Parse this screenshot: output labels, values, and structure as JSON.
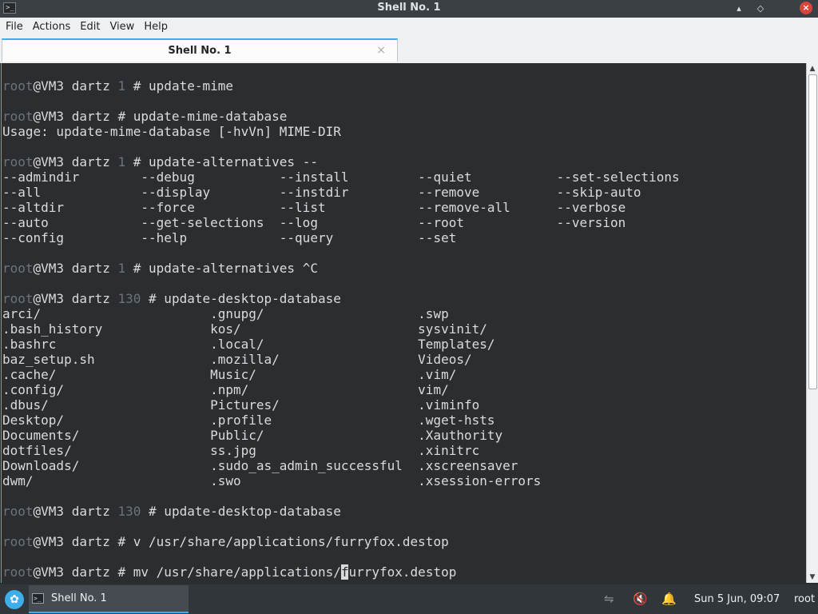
{
  "window": {
    "title": "Shell No. 1",
    "app_icon": "terminal-icon",
    "minimize_glyph": "▴",
    "maximize_glyph": "◇",
    "close_glyph": "×"
  },
  "menu": [
    "File",
    "Actions",
    "Edit",
    "View",
    "Help"
  ],
  "tab": {
    "label": "Shell No. 1",
    "close_glyph": "×"
  },
  "terminal": {
    "lines": [
      [
        {
          "t": "root",
          "c": "dim"
        },
        {
          "t": "@VM3 dartz "
        },
        {
          "t": "1",
          "c": "dim"
        },
        {
          "t": " # update-mime"
        }
      ],
      [],
      [
        {
          "t": "root",
          "c": "dim"
        },
        {
          "t": "@VM3 dartz # update-mime-database"
        }
      ],
      [
        {
          "t": "Usage: update-mime-database [-hvVn] MIME-DIR"
        }
      ],
      [],
      [
        {
          "t": "root",
          "c": "dim"
        },
        {
          "t": "@VM3 dartz "
        },
        {
          "t": "1",
          "c": "dim"
        },
        {
          "t": " # update-alternatives --"
        }
      ],
      [
        {
          "t": "--admindir        --debug           --install         --quiet           --set-selections"
        }
      ],
      [
        {
          "t": "--all             --display         --instdir         --remove          --skip-auto"
        }
      ],
      [
        {
          "t": "--altdir          --force           --list            --remove-all      --verbose"
        }
      ],
      [
        {
          "t": "--auto            --get-selections  --log             --root            --version"
        }
      ],
      [
        {
          "t": "--config          --help            --query           --set"
        }
      ],
      [],
      [
        {
          "t": "root",
          "c": "dim"
        },
        {
          "t": "@VM3 dartz "
        },
        {
          "t": "1",
          "c": "dim"
        },
        {
          "t": " # update-alternatives ^C"
        }
      ],
      [],
      [
        {
          "t": "root",
          "c": "dim"
        },
        {
          "t": "@VM3 dartz "
        },
        {
          "t": "130",
          "c": "dim"
        },
        {
          "t": " # update-desktop-database"
        }
      ],
      [
        {
          "t": "arci/                      .gnupg/                    .swp"
        }
      ],
      [
        {
          "t": ".bash_history              kos/                       sysvinit/"
        }
      ],
      [
        {
          "t": ".bashrc                    .local/                    Templates/"
        }
      ],
      [
        {
          "t": "baz_setup.sh               .mozilla/                  Videos/"
        }
      ],
      [
        {
          "t": ".cache/                    Music/                     .vim/"
        }
      ],
      [
        {
          "t": ".config/                   .npm/                      vim/"
        }
      ],
      [
        {
          "t": ".dbus/                     Pictures/                  .viminfo"
        }
      ],
      [
        {
          "t": "Desktop/                   .profile                   .wget-hsts"
        }
      ],
      [
        {
          "t": "Documents/                 Public/                    .Xauthority"
        }
      ],
      [
        {
          "t": "dotfiles/                  ss.jpg                     .xinitrc"
        }
      ],
      [
        {
          "t": "Downloads/                 .sudo_as_admin_successful  .xscreensaver"
        }
      ],
      [
        {
          "t": "dwm/                       .swo                       .xsession-errors"
        }
      ],
      [],
      [
        {
          "t": "root",
          "c": "dim"
        },
        {
          "t": "@VM3 dartz "
        },
        {
          "t": "130",
          "c": "dim"
        },
        {
          "t": " # update-desktop-database"
        }
      ],
      [],
      [
        {
          "t": "root",
          "c": "dim"
        },
        {
          "t": "@VM3 dartz # v /usr/share/applications/furryfox.destop"
        }
      ],
      [],
      [
        {
          "t": "root",
          "c": "dim"
        },
        {
          "t": "@VM3 dartz # mv /usr/share/applications/"
        },
        {
          "t": "f",
          "c": "cursor"
        },
        {
          "t": "urryfox.destop"
        }
      ]
    ]
  },
  "scrollbar": {
    "up_glyph": "▲",
    "down_glyph": "▼"
  },
  "taskbar": {
    "launcher_icon": "kde-launcher-icon",
    "launcher_glyph": "✿",
    "task_label": "Shell No. 1",
    "network_glyph": "⇋",
    "volume_glyph": "🔇",
    "notify_glyph": "🔔",
    "clock": "Sun  5 Jun, 09:07",
    "user": "root"
  }
}
